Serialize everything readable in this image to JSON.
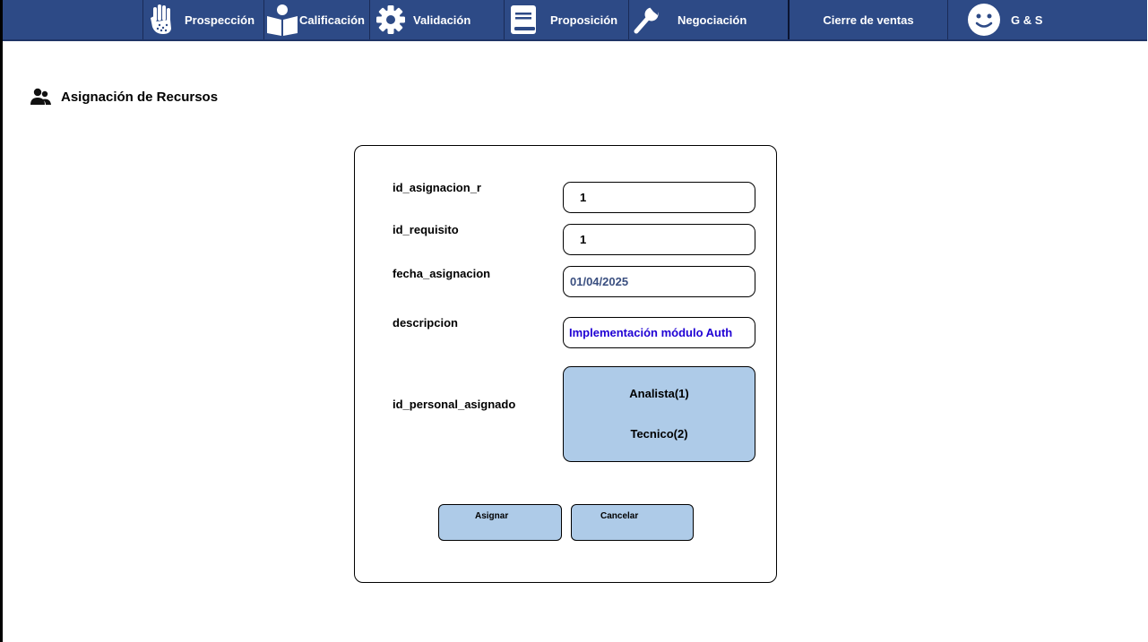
{
  "nav": {
    "items": [
      {
        "label": "Prospección",
        "icon": "hand-icon"
      },
      {
        "label": "Calificación",
        "icon": "reader-icon"
      },
      {
        "label": "Validación",
        "icon": "gear-icon"
      },
      {
        "label": "Proposición",
        "icon": "book-icon"
      },
      {
        "label": "Negociación",
        "icon": "wrench-icon"
      },
      {
        "label": "Cierre de ventas",
        "icon": ""
      }
    ],
    "user": {
      "label": "G & S",
      "icon": "smiley-icon"
    }
  },
  "page": {
    "title": "Asignación de Recursos",
    "icon": "users-icon"
  },
  "form": {
    "fields": [
      {
        "label": "id_asignacion_r",
        "value": "1"
      },
      {
        "label": "id_requisito",
        "value": "1"
      },
      {
        "label": "fecha_asignacion",
        "value": "01/04/2025"
      },
      {
        "label": "descripcion",
        "value": "Implementación módulo Auth"
      }
    ],
    "personal": {
      "label": "id_personal_asignado",
      "options": [
        "Analista(1)",
        "Tecnico(2)"
      ]
    },
    "buttons": {
      "assign": "Asignar",
      "cancel": "Cancelar"
    }
  },
  "colors": {
    "nav_bg": "#2d4a86",
    "button_bg": "#aecbe8",
    "date_text": "#3a4f80",
    "desc_text": "#1f00d4"
  }
}
